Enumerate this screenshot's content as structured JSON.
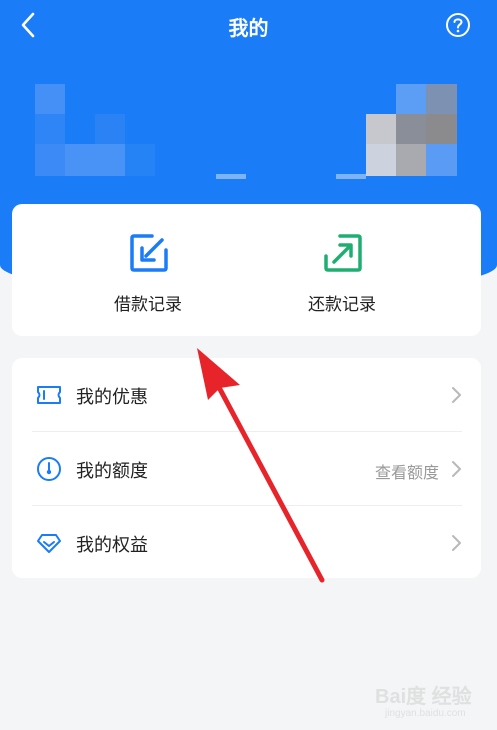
{
  "header": {
    "title": "我的",
    "back_icon": "chevron-left-icon",
    "help_icon": "question-circle-icon",
    "bg_color": "#1a7cf7"
  },
  "records": {
    "borrow_label": "借款记录",
    "repay_label": "还款记录",
    "borrow_icon_color": "#1a7cf7",
    "repay_icon_color": "#1fae72"
  },
  "menu": {
    "items": [
      {
        "label": "我的优惠",
        "extra": ""
      },
      {
        "label": "我的额度",
        "extra": "查看额度"
      },
      {
        "label": "我的权益",
        "extra": ""
      }
    ]
  },
  "annotation": {
    "arrow_color": "#e8242b"
  },
  "watermark": {
    "logo": "Bai度 经验",
    "url": "jingyan.baidu.com"
  }
}
